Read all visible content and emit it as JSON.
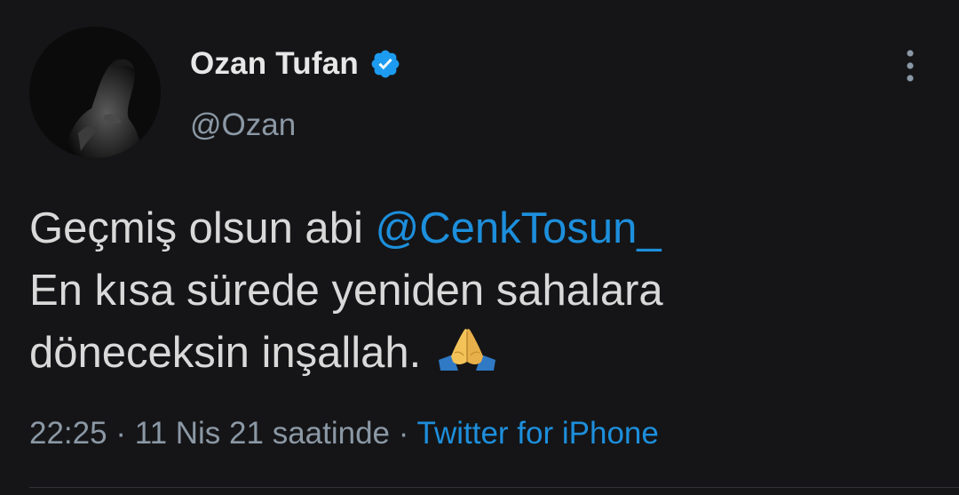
{
  "user": {
    "display_name": "Ozan Tufan",
    "handle": "@Ozan",
    "verified": true
  },
  "tweet": {
    "line1_text": "Geçmiş olsun abi ",
    "line1_mention": "@CenkTosun_",
    "line2_text": "En kısa sürede yeniden sahalara",
    "line3_text": "döneceksin inşallah.",
    "emoji": "folded-hands"
  },
  "meta": {
    "time": "22:25",
    "separator": " · ",
    "date": "11 Nis 21 saatinde",
    "source": "Twitter for iPhone"
  },
  "icons": {
    "verified": "verified-badge-icon",
    "more": "more-vertical-icon"
  },
  "colors": {
    "background": "#151517",
    "accent": "#1d8fdc",
    "secondary_text": "#8b98a5",
    "primary_text": "#d9d9d9"
  }
}
